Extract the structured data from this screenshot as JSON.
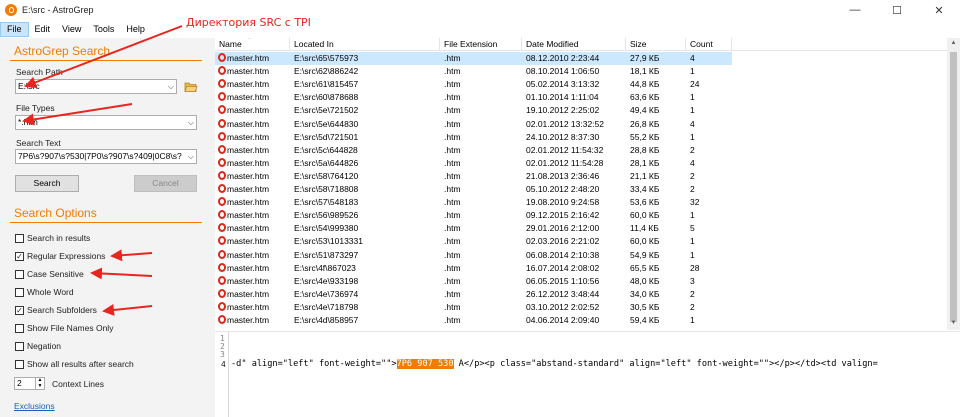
{
  "window": {
    "title": "E:\\src - AstroGrep",
    "minimize": "—",
    "maximize": "☐",
    "close": "✕"
  },
  "menu": [
    "File",
    "Edit",
    "View",
    "Tools",
    "Help"
  ],
  "annotation_text": "Директория SRC с TPI",
  "search_panel": {
    "title": "AstroGrep Search",
    "path_label": "Search Path",
    "path_value": "E:\\src",
    "types_label": "File Types",
    "types_value": "*.htm",
    "text_label": "Search Text",
    "text_value": "7P6\\s?907\\s?530|7P0\\s?907\\s?409|0C8\\s?",
    "search_button": "Search",
    "cancel_button": "Cancel"
  },
  "options": {
    "title": "Search Options",
    "items": [
      {
        "label": "Search in results",
        "checked": false
      },
      {
        "label": "Regular Expressions",
        "checked": true
      },
      {
        "label": "Case Sensitive",
        "checked": false
      },
      {
        "label": "Whole Word",
        "checked": false
      },
      {
        "label": "Search Subfolders",
        "checked": true
      },
      {
        "label": "Show File Names Only",
        "checked": false
      },
      {
        "label": "Negation",
        "checked": false
      },
      {
        "label": "Show all results after search",
        "checked": false
      }
    ],
    "context_lines_value": "2",
    "context_lines_label": "Context Lines",
    "exclusions_link": "Exclusions"
  },
  "table": {
    "columns": [
      "Name",
      "Located In",
      "File Extension",
      "Date Modified",
      "Size",
      "Count"
    ],
    "rows": [
      [
        "master.htm",
        "E:\\src\\65\\575973",
        ".htm",
        "08.12.2010 2:23:44",
        "27,9 КБ",
        "4"
      ],
      [
        "master.htm",
        "E:\\src\\62\\886242",
        ".htm",
        "08.10.2014 1:06:50",
        "18,1 КБ",
        "1"
      ],
      [
        "master.htm",
        "E:\\src\\61\\815457",
        ".htm",
        "05.02.2014 3:13:32",
        "44,8 КБ",
        "24"
      ],
      [
        "master.htm",
        "E:\\src\\60\\878688",
        ".htm",
        "01.10.2014 1:11:04",
        "63,6 КБ",
        "1"
      ],
      [
        "master.htm",
        "E:\\src\\5e\\721502",
        ".htm",
        "19.10.2012 2:25:02",
        "49,4 КБ",
        "1"
      ],
      [
        "master.htm",
        "E:\\src\\5e\\644830",
        ".htm",
        "02.01.2012 13:32:52",
        "26,8 КБ",
        "4"
      ],
      [
        "master.htm",
        "E:\\src\\5d\\721501",
        ".htm",
        "24.10.2012 8:37:30",
        "55,2 КБ",
        "1"
      ],
      [
        "master.htm",
        "E:\\src\\5c\\644828",
        ".htm",
        "02.01.2012 11:54:32",
        "28,8 КБ",
        "2"
      ],
      [
        "master.htm",
        "E:\\src\\5a\\644826",
        ".htm",
        "02.01.2012 11:54:28",
        "28,1 КБ",
        "4"
      ],
      [
        "master.htm",
        "E:\\src\\58\\764120",
        ".htm",
        "21.08.2013 2:36:46",
        "21,1 КБ",
        "2"
      ],
      [
        "master.htm",
        "E:\\src\\58\\718808",
        ".htm",
        "05.10.2012 2:48:20",
        "33,4 КБ",
        "2"
      ],
      [
        "master.htm",
        "E:\\src\\57\\548183",
        ".htm",
        "19.08.2010 9:24:58",
        "53,6 КБ",
        "32"
      ],
      [
        "master.htm",
        "E:\\src\\56\\989526",
        ".htm",
        "09.12.2015 2:16:42",
        "60,0 КБ",
        "1"
      ],
      [
        "master.htm",
        "E:\\src\\54\\999380",
        ".htm",
        "29.01.2016 2:12:00",
        "11,4 КБ",
        "5"
      ],
      [
        "master.htm",
        "E:\\src\\53\\1013331",
        ".htm",
        "02.03.2016 2:21:02",
        "60,0 КБ",
        "1"
      ],
      [
        "master.htm",
        "E:\\src\\51\\873297",
        ".htm",
        "06.08.2014 2:10:38",
        "54,9 КБ",
        "1"
      ],
      [
        "master.htm",
        "E:\\src\\4f\\867023",
        ".htm",
        "16.07.2014 2:08:02",
        "65,5 КБ",
        "28"
      ],
      [
        "master.htm",
        "E:\\src\\4e\\933198",
        ".htm",
        "06.05.2015 1:10:56",
        "48,0 КБ",
        "3"
      ],
      [
        "master.htm",
        "E:\\src\\4e\\736974",
        ".htm",
        "26.12.2012 3:48:44",
        "34,0 КБ",
        "2"
      ],
      [
        "master.htm",
        "E:\\src\\4e\\718798",
        ".htm",
        "03.10.2012 2:02:52",
        "30,5 КБ",
        "2"
      ],
      [
        "master.htm",
        "E:\\src\\4d\\858957",
        ".htm",
        "04.06.2014 2:09:40",
        "59,4 КБ",
        "1"
      ]
    ]
  },
  "preview": {
    "line_numbers": [
      "1",
      "2",
      "3",
      "4"
    ],
    "before": "-d\" align=\"left\" font-weight=\"\">",
    "match": "7P6 907 530",
    "after": " A</p><p class=\"abstand-standard\" align=\"left\" font-weight=\"\"></p></td><td valign="
  },
  "colors": {
    "accent": "#f07c00",
    "annotation": "#e8251e",
    "selected_row": "#cce8ff"
  }
}
